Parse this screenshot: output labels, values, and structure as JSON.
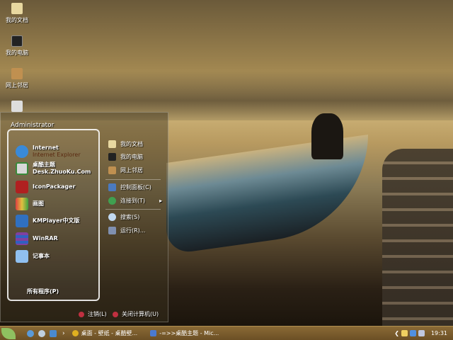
{
  "desktop": {
    "icons": [
      {
        "label": "我的文档"
      },
      {
        "label": "我的电脑"
      },
      {
        "label": "网上邻居"
      },
      {
        "label": ""
      }
    ]
  },
  "start_menu": {
    "user": "Administrator",
    "programs": [
      {
        "title": "Internet",
        "subtitle": "Internet Explorer",
        "icon": "ie-icon",
        "color": "#3a8ad8"
      },
      {
        "title": "桌酷主题",
        "subtitle": "Desk.ZhuoKu.Com",
        "icon": "theme-icon",
        "color": "#d8d8d8"
      },
      {
        "title": "IconPackager",
        "subtitle": "",
        "icon": "iconpackager-icon",
        "color": "#b02020"
      },
      {
        "title": "画图",
        "subtitle": "",
        "icon": "paint-icon",
        "color": "#e0c040"
      },
      {
        "title": "KMPlayer中文版",
        "subtitle": "",
        "icon": "kmplayer-icon",
        "color": "#3070c0"
      },
      {
        "title": "WinRAR",
        "subtitle": "",
        "icon": "winrar-icon",
        "color": "#8040a0"
      },
      {
        "title": "记事本",
        "subtitle": "",
        "icon": "notepad-icon",
        "color": "#90c0f0"
      }
    ],
    "all_programs": "所有程序(P)",
    "places": [
      {
        "label": "我的文档",
        "icon": "my-documents-icon"
      },
      {
        "label": "我的电脑",
        "icon": "my-computer-icon"
      },
      {
        "label": "网上邻居",
        "icon": "network-icon"
      },
      {
        "label": "控制面板(C)",
        "icon": "control-panel-icon"
      },
      {
        "label": "连接到(T)",
        "icon": "connect-icon",
        "arrow": "▸"
      },
      {
        "label": "搜索(S)",
        "icon": "search-icon"
      },
      {
        "label": "运行(R)...",
        "icon": "run-icon"
      }
    ],
    "logoff": "注销(L)",
    "shutdown": "关闭计算机(U)"
  },
  "taskbar": {
    "quicklaunch_arrow": "›",
    "tasks": [
      {
        "label": "桌面 - 壁纸 - 桌酷壁...",
        "icon": "chrome-icon"
      },
      {
        "label": "-=>>桌酷主题 - Mic...",
        "icon": "word-icon"
      }
    ],
    "tray_arrow": "❮",
    "clock": "19:31"
  }
}
